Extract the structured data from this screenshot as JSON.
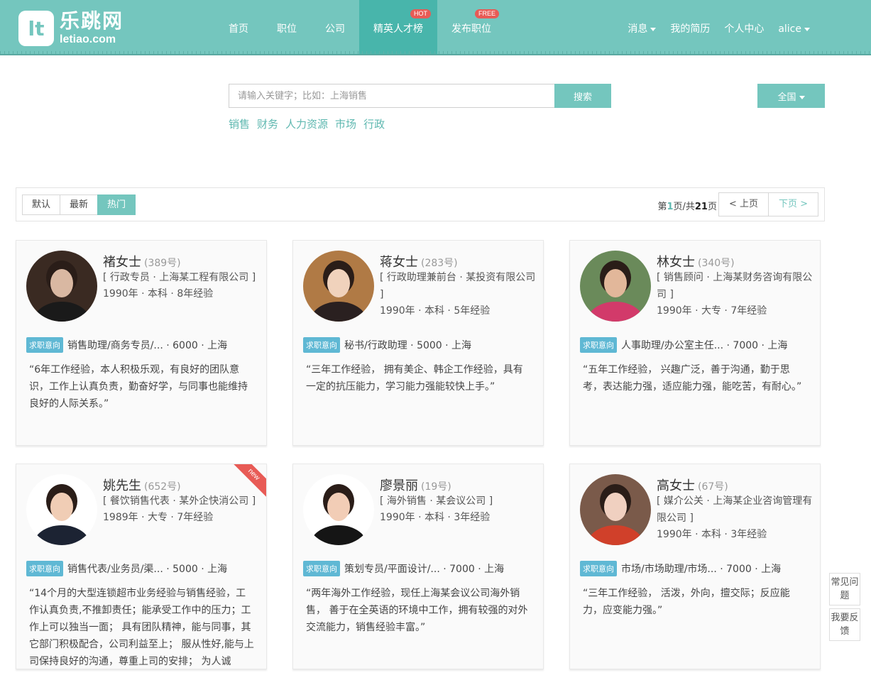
{
  "header": {
    "logo_mark": "lt",
    "logo_cn": "乐跳网",
    "logo_en": "letiao.com",
    "nav": [
      {
        "label": "首页"
      },
      {
        "label": "职位"
      },
      {
        "label": "公司"
      },
      {
        "label": "精英人才榜",
        "badge": "HOT",
        "active": true
      },
      {
        "label": "发布职位",
        "badge": "FREE"
      }
    ],
    "right_nav": [
      {
        "label": "消息",
        "dropdown": true
      },
      {
        "label": "我的简历"
      },
      {
        "label": "个人中心"
      },
      {
        "label": "alice",
        "dropdown": true
      }
    ]
  },
  "search": {
    "placeholder": "请输入关键字；比如：上海销售",
    "button_label": "搜索",
    "hot_tags": [
      "销售",
      "财务",
      "人力资源",
      "市场",
      "行政"
    ],
    "region_label": "全国"
  },
  "toolbar": {
    "sort_options": [
      {
        "label": "默认"
      },
      {
        "label": "最新"
      },
      {
        "label": "热门",
        "active": true
      }
    ],
    "page_prefix": "第",
    "page_current": "1",
    "page_middle": "页/共",
    "page_total": "21",
    "page_suffix": "页",
    "prev_label": "< 上页",
    "next_label": "下页 >"
  },
  "intent_label": "求职意向",
  "candidates": [
    {
      "name": "褚女士",
      "number": "(389号)",
      "job": "[ 行政专员 · 上海某工程有限公司 ]",
      "meta": "1990年 · 本科 · 8年经验",
      "intent": "销售助理/商务专员/... · 6000 · 上海",
      "quote": "“6年工作经验，本人积极乐观，有良好的团队意识，工作上认真负责，勤奋好学，与同事也能维持良好的人际关系。”",
      "avatar_colors": [
        "#3a2a22",
        "#d9b8a2",
        "#1a1a1a"
      ],
      "is_new": false
    },
    {
      "name": "蒋女士",
      "number": "(283号)",
      "job": "[ 行政助理兼前台 · 某投资有限公司 ]",
      "meta": "1990年 · 本科 · 5年经验",
      "intent": "秘书/行政助理 · 5000 · 上海",
      "quote": "“三年工作经验， 拥有美企、韩企工作经验，具有一定的抗压能力，学习能力强能较快上手。”",
      "avatar_colors": [
        "#b07a45",
        "#f0d2bc",
        "#2a2020"
      ],
      "is_new": false
    },
    {
      "name": "林女士",
      "number": "(340号)",
      "job": "[ 销售顾问 · 上海某财务咨询有限公司 ]",
      "meta": "1990年 · 大专 · 7年经验",
      "intent": "人事助理/办公室主任... · 7000 · 上海",
      "quote": "“五年工作经验， 兴趣广泛，善于沟通，勤于思考，表达能力强，适应能力强，能吃苦，有耐心。”",
      "avatar_colors": [
        "#6a8a5a",
        "#e2b79a",
        "#d23a6a"
      ],
      "is_new": false
    },
    {
      "name": "姚先生",
      "number": "(652号)",
      "job": "[ 餐饮销售代表 · 某外企快消公司 ]",
      "meta": "1989年 · 大专 · 7年经验",
      "intent": "销售代表/业务员/渠... · 5000 · 上海",
      "quote": "“14个月的大型连锁超市业务经验与销售经验，工作认真负责,不推卸责任；能承受工作中的压力；工作上可以独当一面； 具有团队精神，能与同事，其它部门积极配合，公司利益至上； 服从性好,能与上司保持良好的沟通，尊重上司的安排； 为人诚",
      "avatar_colors": [
        "#ffffff",
        "#f0cdb5",
        "#1c2333"
      ],
      "is_new": true,
      "new_label": "new"
    },
    {
      "name": "廖景丽",
      "number": "(19号)",
      "job": "[ 海外销售 · 某会议公司 ]",
      "meta": "1990年 · 本科 · 3年经验",
      "intent": "策划专员/平面设计/... · 7000 · 上海",
      "quote": "“两年海外工作经验，现任上海某会议公司海外销售， 善于在全英语的环境中工作，拥有较强的对外交流能力，销售经验丰富。”",
      "avatar_colors": [
        "#ffffff",
        "#f2cdb6",
        "#151515"
      ],
      "is_new": false
    },
    {
      "name": "高女士",
      "number": "(67号)",
      "job": "[ 媒介公关 · 上海某企业咨询管理有限公司 ]",
      "meta": "1990年 · 本科 · 3年经验",
      "intent": "市场/市场助理/市场... · 7000 · 上海",
      "quote": "“三年工作经验， 活泼，外向，擅交际；反应能力，应变能力强。”",
      "avatar_colors": [
        "#7a5a4a",
        "#f0d0c0",
        "#d0402a"
      ],
      "is_new": false
    }
  ],
  "side": {
    "faq_label": "常见问题",
    "feedback_label": "我要反馈"
  },
  "colors": {
    "brand": "#74c6be",
    "brand_dark": "#48b5ab",
    "badge_red": "#e85b56",
    "intent_blue": "#5fb8d4"
  }
}
